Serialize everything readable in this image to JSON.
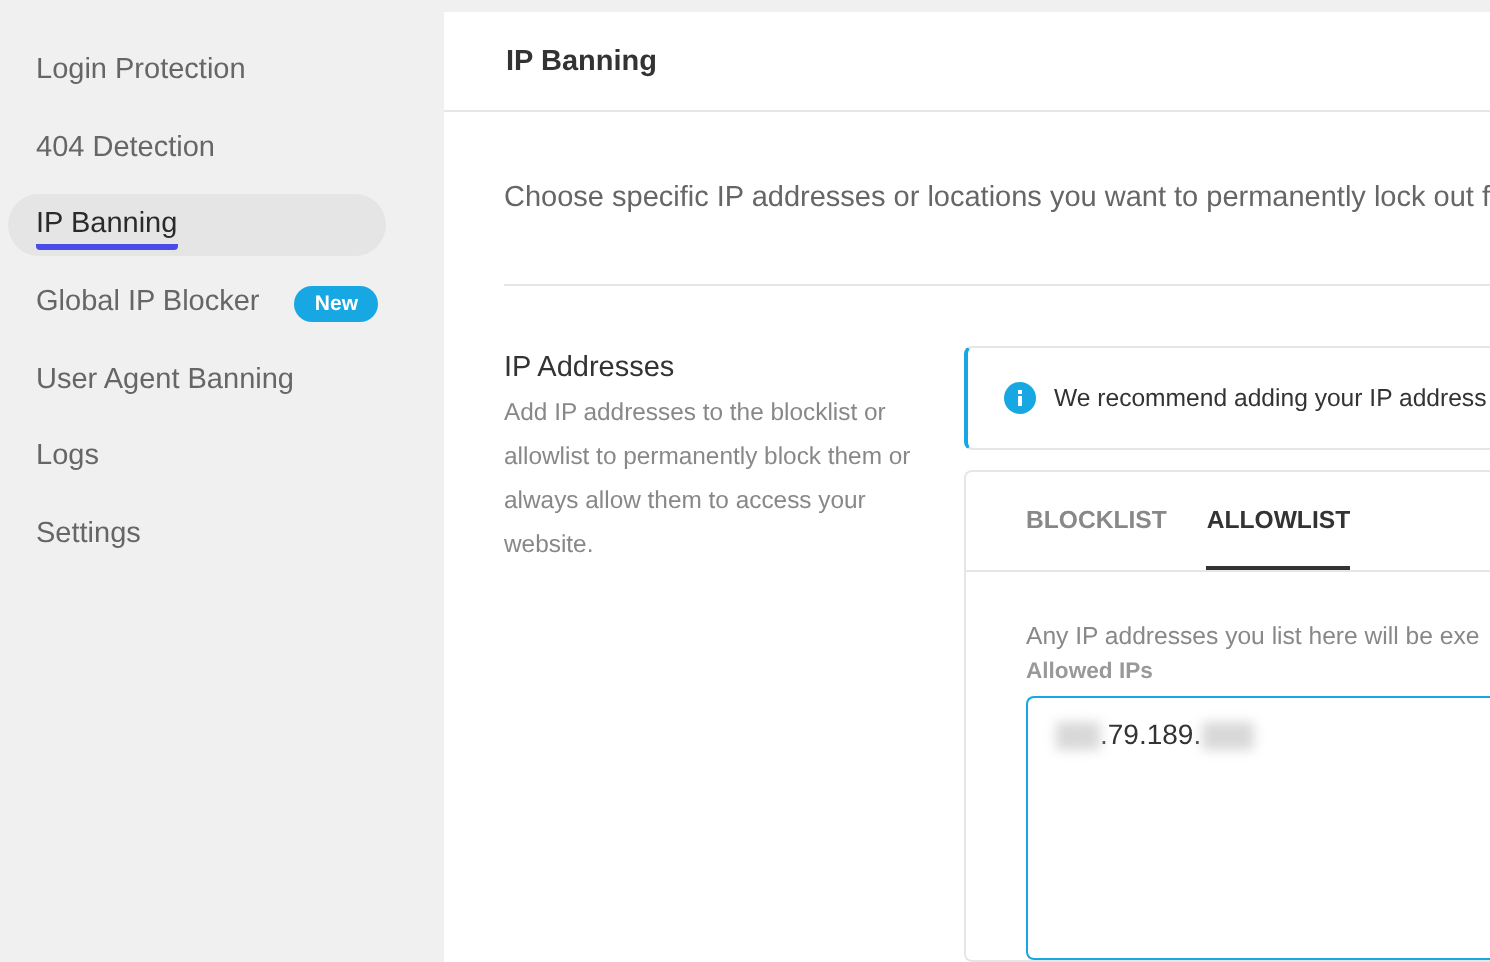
{
  "sidebar": {
    "items": [
      {
        "label": "Login Protection",
        "selected": false
      },
      {
        "label": "404 Detection",
        "selected": false
      },
      {
        "label": "IP Banning",
        "selected": true
      },
      {
        "label": "Global IP Blocker",
        "selected": false,
        "badge": "New"
      },
      {
        "label": "User Agent Banning",
        "selected": false
      },
      {
        "label": "Logs",
        "selected": false
      },
      {
        "label": "Settings",
        "selected": false
      }
    ]
  },
  "header": {
    "title": "IP Banning"
  },
  "intro": "Choose specific IP addresses or locations you want to permanently lock out f",
  "section": {
    "title": "IP Addresses",
    "description": "Add IP addresses to the blocklist or allowlist to permanently block them or always allow them to access your website.",
    "notice": "We recommend adding your IP address",
    "tabs": [
      {
        "label": "BLOCKLIST",
        "selected": false
      },
      {
        "label": "ALLOWLIST",
        "selected": true
      }
    ],
    "tab_text": "Any IP addresses you list here will be exe",
    "field_label": "Allowed IPs",
    "field_value": ".79.189."
  }
}
